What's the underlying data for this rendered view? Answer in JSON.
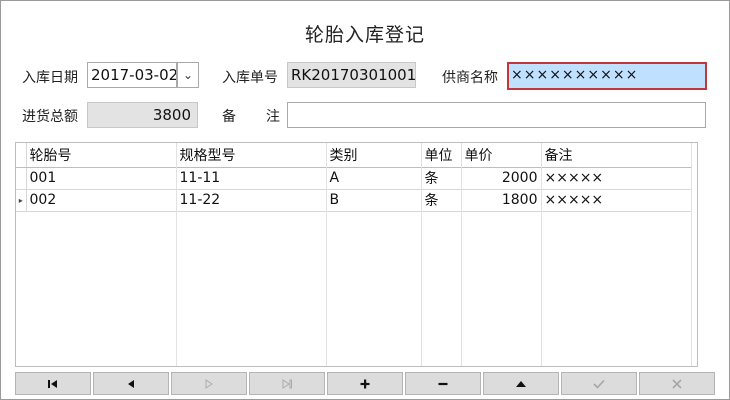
{
  "window": {
    "title": "轮胎入库登记"
  },
  "form": {
    "date_label": "入库日期",
    "date_value": "2017-03-02",
    "order_label": "入库单号",
    "order_value": "RK20170301001",
    "supplier_label": "供商名称",
    "supplier_value": "××××××××××",
    "total_label": "进货总额",
    "total_value": "3800",
    "remark_label_1": "备",
    "remark_label_2": "注",
    "remark_value": ""
  },
  "grid": {
    "columns": [
      "轮胎号",
      "规格型号",
      "类别",
      "单位",
      "单价",
      "备注"
    ],
    "rows": [
      {
        "tire_no": "001",
        "spec": "11-11",
        "category": "A",
        "unit": "条",
        "price": "2000",
        "remark": "×××××"
      },
      {
        "tire_no": "002",
        "spec": "11-22",
        "category": "B",
        "unit": "条",
        "price": "1800",
        "remark": "×××××"
      }
    ],
    "current_row_indicator": "▸"
  },
  "toolbar": {
    "buttons": [
      {
        "icon": "first-record-icon",
        "enabled": true
      },
      {
        "icon": "previous-record-icon",
        "enabled": true
      },
      {
        "icon": "next-record-icon",
        "enabled": false
      },
      {
        "icon": "last-record-icon",
        "enabled": false
      },
      {
        "icon": "add-icon",
        "enabled": true
      },
      {
        "icon": "delete-icon",
        "enabled": true
      },
      {
        "icon": "edit-icon",
        "enabled": true
      },
      {
        "icon": "confirm-icon",
        "enabled": false
      },
      {
        "icon": "cancel-icon",
        "enabled": false
      }
    ]
  }
}
